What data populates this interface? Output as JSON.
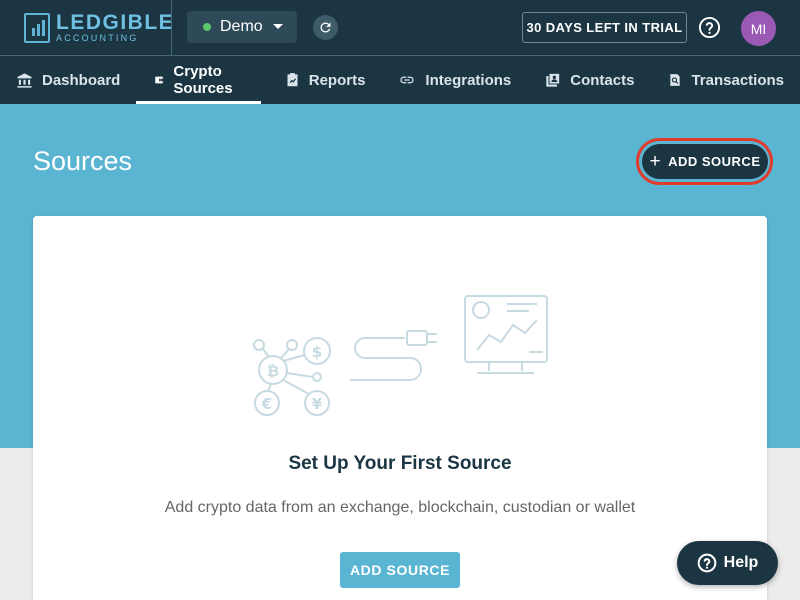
{
  "brand": {
    "title": "LEDGIBLE",
    "subtitle": "ACCOUNTING"
  },
  "topbar": {
    "workspace": "Demo",
    "trial_text": "30 DAYS LEFT IN TRIAL",
    "avatar_initials": "MI"
  },
  "nav": {
    "items": [
      {
        "label": "Dashboard",
        "icon": "bank-icon"
      },
      {
        "label": "Crypto Sources",
        "icon": "wallet-icon",
        "active": true
      },
      {
        "label": "Reports",
        "icon": "report-icon"
      },
      {
        "label": "Integrations",
        "icon": "link-icon"
      },
      {
        "label": "Contacts",
        "icon": "contacts-icon"
      },
      {
        "label": "Transactions",
        "icon": "transactions-icon"
      }
    ]
  },
  "page": {
    "title": "Sources",
    "add_source_label": "ADD SOURCE"
  },
  "empty_state": {
    "title": "Set Up Your First Source",
    "subtitle": "Add crypto data from an exchange, blockchain, custodian or wallet",
    "button_label": "ADD SOURCE"
  },
  "help": {
    "label": "Help"
  },
  "colors": {
    "header_bg": "#1b3543",
    "band_bg": "#5ab5d3",
    "highlight_ring": "#e03c2b",
    "status_dot": "#5cc56a",
    "avatar_bg": "#9b59b6"
  }
}
